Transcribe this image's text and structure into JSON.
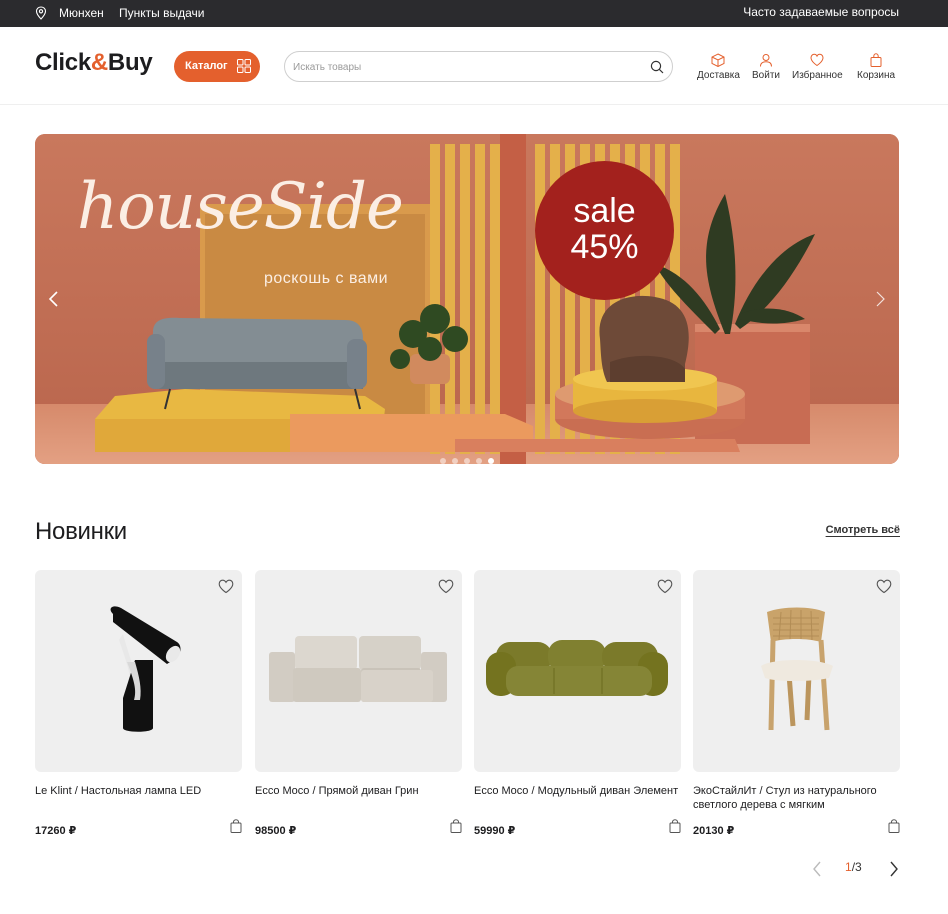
{
  "topbar": {
    "city": "Мюнхен",
    "pickup": "Пункты выдачи",
    "faq": "Часто задаваемые вопросы"
  },
  "header": {
    "logo_prefix": "Click",
    "logo_amp": "&",
    "logo_suffix": "Buy",
    "catalog_label": "Каталог",
    "search_placeholder": "Искать товары",
    "nav": [
      {
        "label": "Доставка",
        "icon": "box-icon"
      },
      {
        "label": "Войти",
        "icon": "user-icon"
      },
      {
        "label": "Избранное",
        "icon": "heart-icon"
      },
      {
        "label": "Корзина",
        "icon": "bag-icon"
      }
    ]
  },
  "banner": {
    "brand": "houseSide",
    "tagline": "роскошь с вами",
    "sale_word": "sale",
    "sale_percent": "45%",
    "slide_count": 5,
    "active_slide": 5,
    "colors": {
      "background": "#c77a60",
      "sale": "#a3211d"
    }
  },
  "new_section": {
    "title": "Новинки",
    "see_all": "Смотреть всё",
    "products": [
      {
        "name": "Le Klint / Настольная лампа LED",
        "price": "17260 ₽",
        "image": "desk-lamp"
      },
      {
        "name": "Ecco Moco / Прямой диван Грин",
        "price": "98500 ₽",
        "image": "beige-sofa"
      },
      {
        "name": "Ecco Moco / Модульный диван Элемент",
        "price": "59990 ₽",
        "image": "green-sofa"
      },
      {
        "name": "ЭкоСтайлИт / Стул из натурального светлого дерева с мягким",
        "price": "20130 ₽",
        "image": "wooden-chair"
      }
    ],
    "pager": {
      "current": "1",
      "sep": "/",
      "total": "3"
    }
  },
  "accent_color": "#e4602d"
}
